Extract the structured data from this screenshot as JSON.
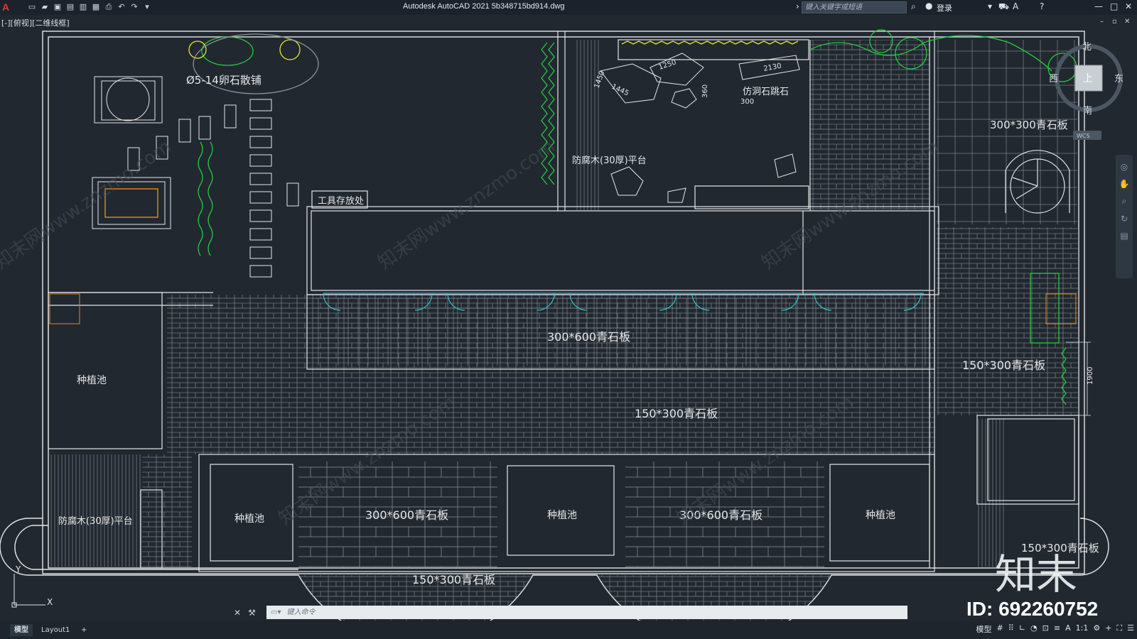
{
  "app": {
    "title": "Autodesk AutoCAD 2021    5b348715bd914.dwg",
    "logo": "A",
    "search_placeholder": "键入关键字或短语",
    "login_label": "登录"
  },
  "qat_icons": [
    "new-icon",
    "open-icon",
    "save-icon",
    "saveas-icon",
    "publish-icon",
    "plot-icon",
    "print-icon",
    "undo-icon",
    "redo-icon",
    "more-icon"
  ],
  "viewport": {
    "label": "[-][俯视][二维线框]"
  },
  "viewcube": {
    "north": "北",
    "south": "南",
    "east": "东",
    "west": "西",
    "top": "上",
    "wcs": "WCS"
  },
  "drawing": {
    "labels": {
      "pebble": "Ø5-14卵石散铺",
      "tool_storage": "工具存放处",
      "stepping_stone": "仿洞石跳石",
      "wood_platform_top": "防腐木(30厚)平台",
      "wood_platform_left": "防腐木(30厚)平台",
      "bluestone_300_300": "300*300青石板",
      "bluestone_300_600_mid": "300*600青石板",
      "bluestone_150_300_right": "150*300青石板",
      "bluestone_150_300_center": "150*300青石板",
      "bluestone_300_600_left": "300*600青石板",
      "bluestone_300_600_right": "300*600青石板",
      "bluestone_150_300_bottom": "150*300青石板",
      "bluestone_150_300_corner": "150*300青石板",
      "planter_left": "种植池",
      "planter_1": "种植池",
      "planter_2": "种植池",
      "planter_3": "种植池"
    },
    "dimensions": {
      "d1": "1250",
      "d2": "2130",
      "d3": "1445",
      "d4": "1450",
      "d5": "360",
      "d6": "300",
      "d7": "1900"
    },
    "watermark_text": "知末网www.znzmo.com"
  },
  "command_line": {
    "placeholder": "键入命令"
  },
  "tabs": [
    {
      "label": "模型",
      "active": true
    },
    {
      "label": "Layout1",
      "active": false
    },
    {
      "label": "+",
      "active": false
    }
  ],
  "status_bar": {
    "model_label": "模型",
    "scale": "1:1"
  },
  "watermark": {
    "brand": "知末",
    "id": "ID: 692260752"
  },
  "colors": {
    "background": "#212830",
    "line": "#e6e6e6",
    "green": "#28c840",
    "cyan": "#2fc3c8",
    "orange": "#e08a2a",
    "yellow": "#e6e62a"
  }
}
